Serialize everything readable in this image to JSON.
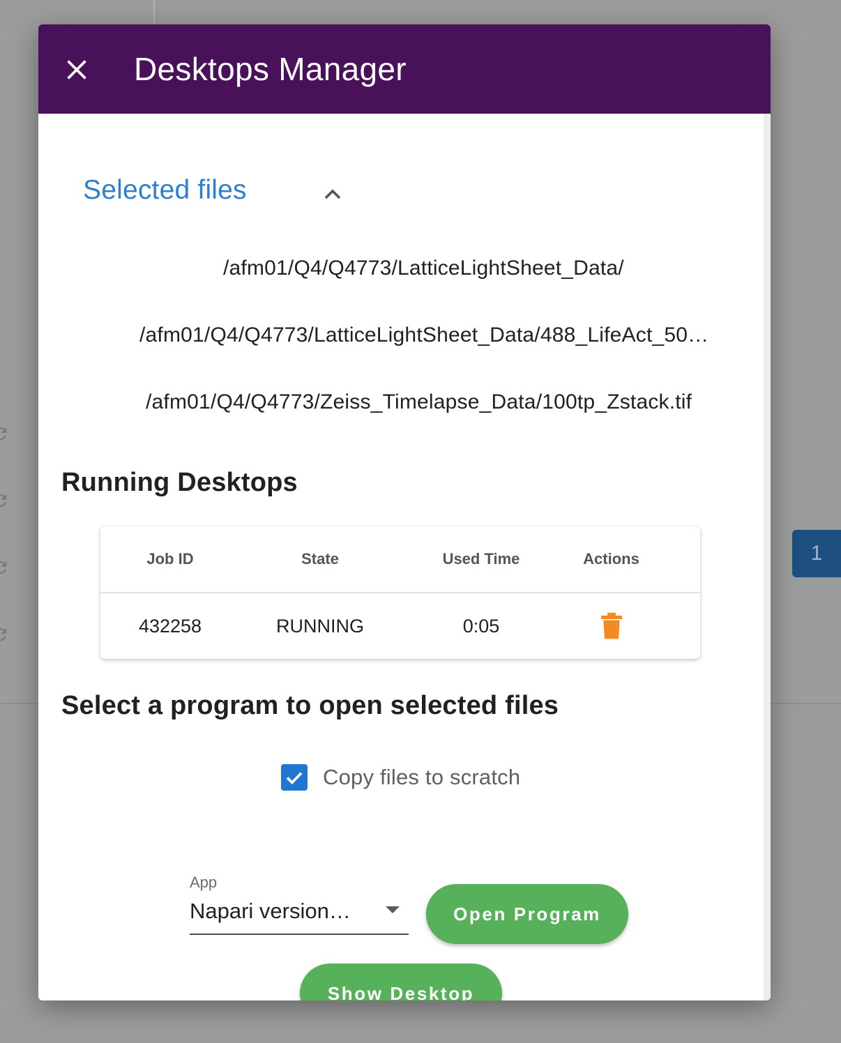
{
  "background": {
    "page_number": "1"
  },
  "dialog": {
    "title": "Desktops Manager",
    "close_icon": "close-icon",
    "header_color": "#491159"
  },
  "selected_files": {
    "title": "Selected files",
    "expanded": true,
    "files": [
      "/afm01/Q4/Q4773/LatticeLightSheet_Data/",
      "/afm01/Q4/Q4773/LatticeLightSheet_Data/488_LifeAct_50…",
      "/afm01/Q4/Q4773/Zeiss_Timelapse_Data/100tp_Zstack.tif"
    ]
  },
  "running_desktops": {
    "title": "Running Desktops",
    "columns": [
      "Job ID",
      "State",
      "Used Time",
      "Actions"
    ],
    "rows": [
      {
        "job_id": "432258",
        "state": "RUNNING",
        "used_time": "0:05",
        "action_icon": "trash-icon"
      }
    ],
    "action_color": "#f28c1e"
  },
  "open_program": {
    "title": "Select a program to open selected files",
    "copy_checkbox": {
      "label": "Copy files to scratch",
      "checked": true
    },
    "app_select": {
      "label": "App",
      "value": "Napari version…"
    },
    "open_button": "Open Program",
    "show_button": "Show Desktop",
    "button_color": "#57b05a"
  }
}
